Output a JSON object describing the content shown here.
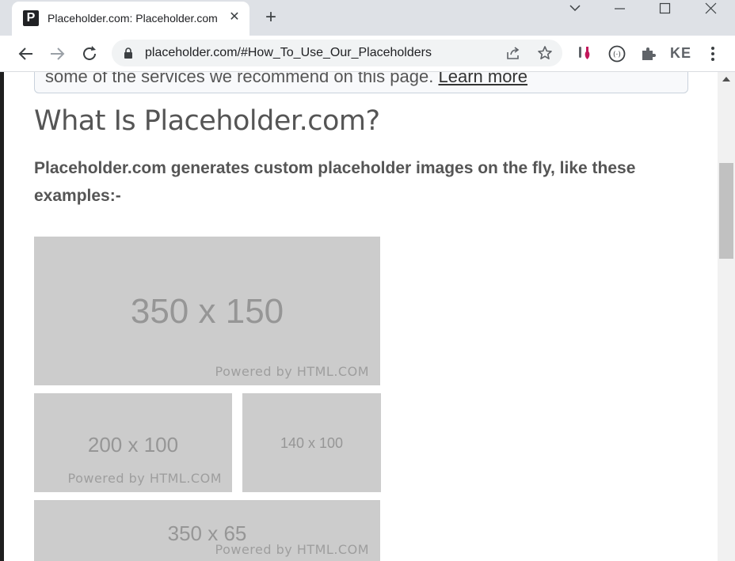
{
  "browser": {
    "tab": {
      "favicon_letter": "P",
      "title": "Placeholder.com: Placeholder.com",
      "close_glyph": "✕"
    },
    "new_tab_glyph": "+",
    "url": "placeholder.com/#How_To_Use_Our_Placeholders",
    "profile_initials": "KE"
  },
  "page": {
    "notice": {
      "text": "some of the services we recommend on this page.",
      "link": "Learn more"
    },
    "heading": "What Is Placeholder.com?",
    "intro": "Placeholder.com generates custom placeholder images on the fly, like these examples:-",
    "placeholders": [
      {
        "size_label": "350 x 150",
        "powered": "Powered by HTML.COM"
      },
      {
        "size_label": "200 x 100",
        "powered": "Powered by HTML.COM"
      },
      {
        "size_label": "140 x 100"
      },
      {
        "size_label": "350 x 65",
        "powered": "Powered by HTML.COM"
      }
    ]
  },
  "colors": {
    "placeholder_bg": "#cccccc",
    "tabstrip_bg": "#dee1e6",
    "text": "#555555"
  }
}
